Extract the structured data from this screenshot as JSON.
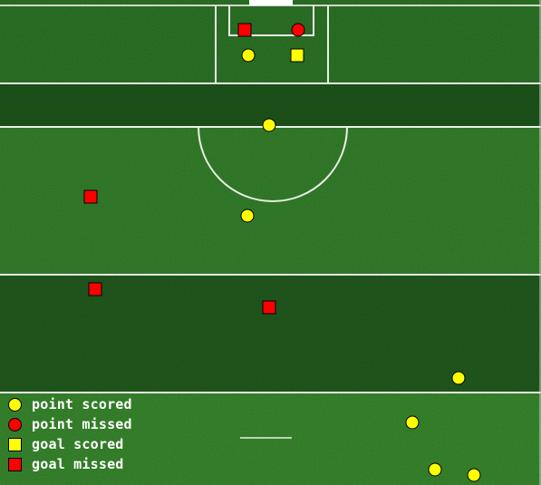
{
  "colors": {
    "grass_light": "#3a8a2e",
    "grass_dark": "#1d4f1a",
    "lines": "#e9efe5",
    "scored": "#ffff00",
    "missed": "#ff0000",
    "outline": "#000000"
  },
  "legend": [
    {
      "shape": "circle",
      "color": "#ffff00",
      "label": "point scored"
    },
    {
      "shape": "circle",
      "color": "#ff0000",
      "label": "point missed"
    },
    {
      "shape": "square",
      "color": "#ffff00",
      "label": "goal scored"
    },
    {
      "shape": "square",
      "color": "#ff0000",
      "label": "goal missed"
    }
  ],
  "shots": [
    {
      "outcome": "goal missed"
    },
    {
      "outcome": "point missed"
    },
    {
      "outcome": "point scored"
    },
    {
      "outcome": "goal scored"
    },
    {
      "outcome": "point scored"
    },
    {
      "outcome": "goal missed"
    },
    {
      "outcome": "point scored"
    },
    {
      "outcome": "goal missed"
    },
    {
      "outcome": "goal missed"
    },
    {
      "outcome": "point scored"
    },
    {
      "outcome": "point scored"
    },
    {
      "outcome": "point scored"
    },
    {
      "outcome": "point scored"
    }
  ]
}
